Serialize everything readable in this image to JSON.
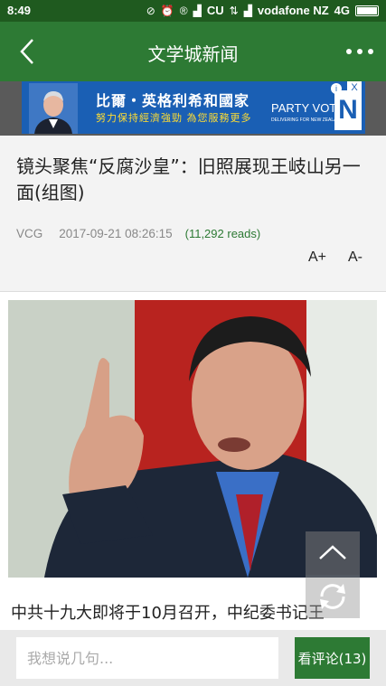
{
  "status_bar": {
    "time": "8:49",
    "carrier_short": "CU",
    "carrier": "vodafone NZ",
    "network": "4G"
  },
  "app_bar": {
    "title": "文学城新闻",
    "back_icon": "chevron-left-icon",
    "more_icon": "more-dots-icon"
  },
  "ad": {
    "headline": "比爾・英格利希和國家",
    "subline": "努力保持經濟強勁 為您服務更多",
    "party": "PARTY VOTE",
    "party_sub": "DELIVERING FOR NEW ZEALANDERS",
    "logo_letter": "N",
    "info_icon": "i",
    "close_icon": "X"
  },
  "article": {
    "headline": "镜头聚焦“反腐沙皇”：旧照展现王岐山另一面(组图)",
    "source": "VCG",
    "datetime": "2017-09-21 08:26:15",
    "reads": "(11,292 reads)",
    "font_increase": "A+",
    "font_decrease": "A-",
    "body_first_line": "中共十九大即将于10月召开，中纪委书记王"
  },
  "bottom_bar": {
    "comment_placeholder": "我想说几句...",
    "comments_button": "看评论(13)"
  },
  "colors": {
    "status_bar": "#1f5a1f",
    "app_bar": "#2d7a34",
    "accent_green": "#2d7a34",
    "ad_blue": "#1a5fb4"
  }
}
